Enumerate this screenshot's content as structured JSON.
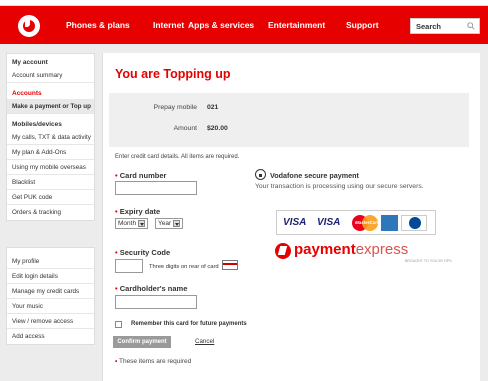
{
  "nav": {
    "items": [
      "Phones & plans",
      "Internet",
      "Apps & services",
      "Entertainment",
      "Support"
    ],
    "search_placeholder": "Search"
  },
  "sidebar": {
    "my_account": {
      "heading": "My account",
      "items": [
        "Account summary"
      ]
    },
    "accounts": {
      "heading": "Accounts",
      "items": [
        "Make a payment or Top up"
      ]
    },
    "mobiles": {
      "heading": "Mobiles/devices",
      "items": [
        "My calls, TXT & data activity",
        "My plan & Add-Ons",
        "Using my mobile overseas",
        "Blacklist",
        "Get PUK code",
        "Orders & tracking"
      ]
    },
    "profile": {
      "items": [
        "My profile",
        "Edit login details",
        "Manage my credit cards",
        "Your music",
        "View / remove access",
        "Add access"
      ]
    }
  },
  "main": {
    "title": "You are Topping up",
    "summary": {
      "prepay_label": "Prepay mobile",
      "prepay_value": "021",
      "amount_label": "Amount",
      "amount_value": "$20.00"
    },
    "instructions": "Enter credit card details. All items are required.",
    "card_number_label": "Card number",
    "expiry_label": "Expiry date",
    "month_value": "Month",
    "year_value": "Year",
    "security_label": "Security Code",
    "security_hint": "Three digits on rear of card",
    "cardholder_label": "Cardholder's name",
    "remember_label": "Remember this card for future payments",
    "confirm_label": "Confirm payment",
    "cancel_label": "Cancel",
    "required_note": "These items are required",
    "required_marker": "•"
  },
  "secure": {
    "title": "Vodafone secure payment",
    "text": "Your transaction is processing using our secure servers.",
    "visa": "VISA",
    "visa_debit": "VISA",
    "mastercard": "MasterCard",
    "pe_brand_a": "payment",
    "pe_brand_b": "express",
    "pe_tagline": "BROUGHT TO YOU BY DPS"
  },
  "colors": {
    "brand_red": "#e60000"
  }
}
